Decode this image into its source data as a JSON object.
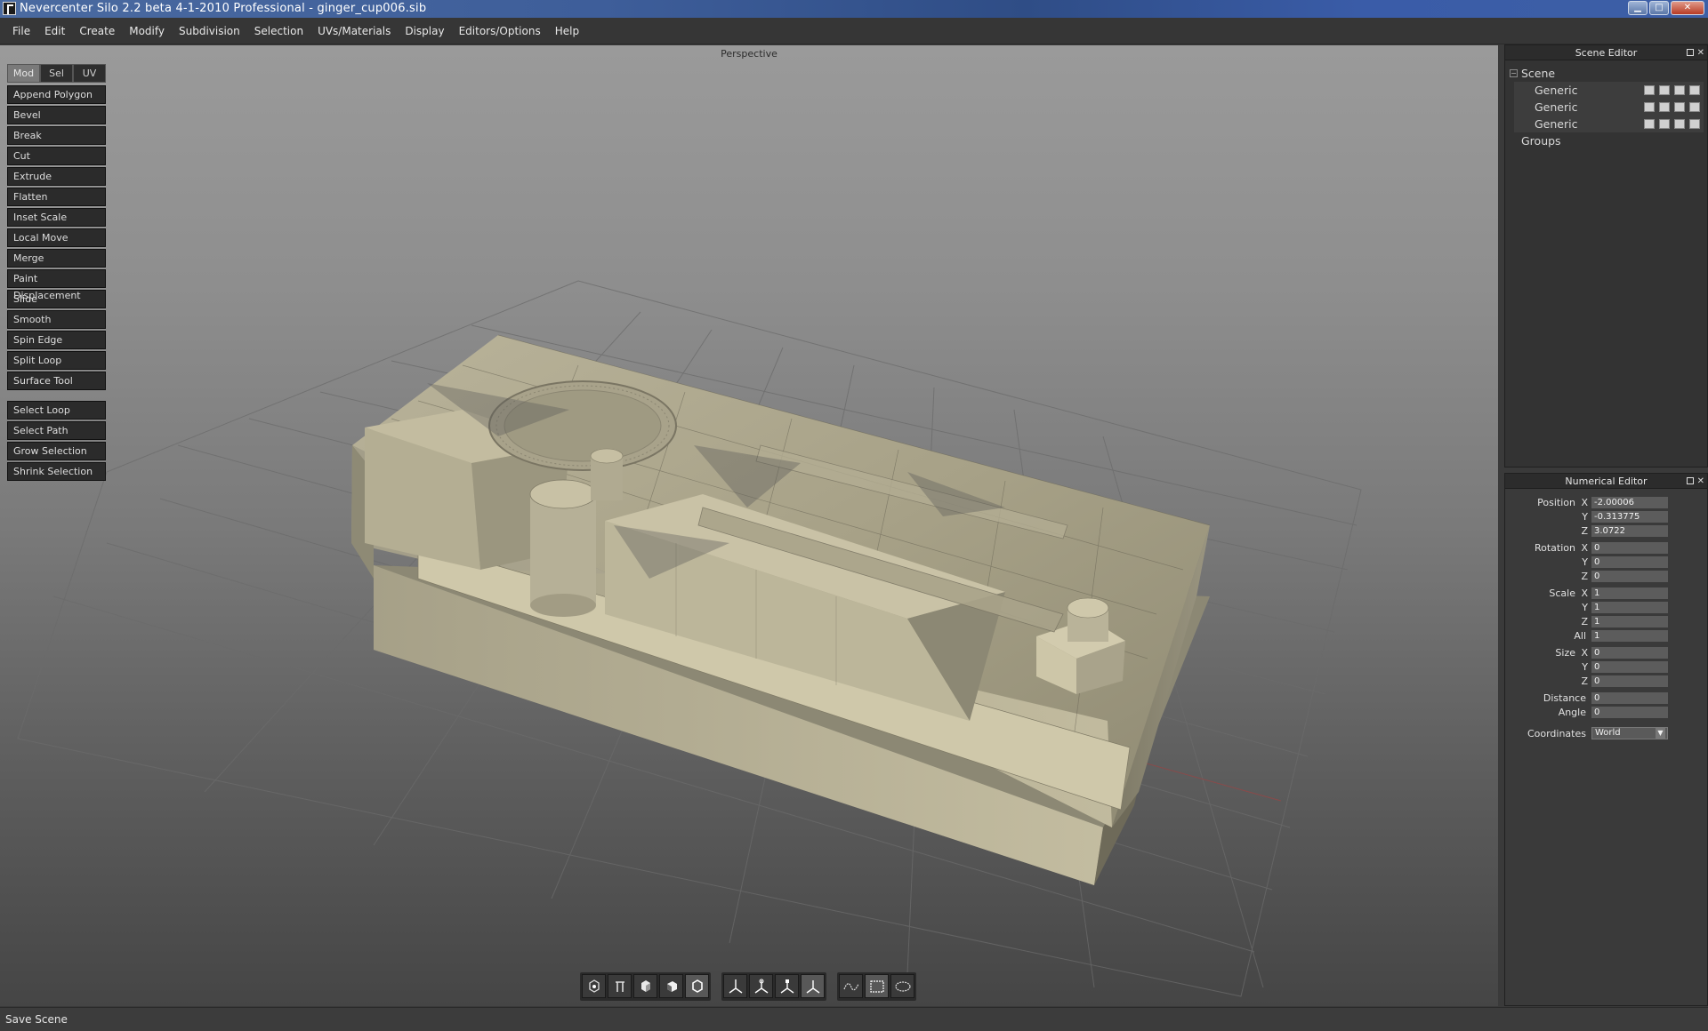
{
  "window": {
    "title": "Nevercenter Silo 2.2 beta 4-1-2010 Professional - ginger_cup006.sib"
  },
  "menu": [
    "File",
    "Edit",
    "Create",
    "Modify",
    "Subdivision",
    "Selection",
    "UVs/Materials",
    "Display",
    "Editors/Options",
    "Help"
  ],
  "viewport": {
    "label": "Perspective"
  },
  "toolpanel": {
    "tabs": [
      "Mod",
      "Sel",
      "UV"
    ],
    "active_tab": "Mod",
    "modeling_tools": [
      "Append Polygon",
      "Bevel",
      "Break",
      "Cut",
      "Extrude",
      "Flatten",
      "Inset Scale",
      "Local Move",
      "Merge",
      "Paint Displacement",
      "Slide",
      "Smooth",
      "Spin Edge",
      "Split Loop",
      "Surface Tool"
    ],
    "selection_tools": [
      "Select Loop",
      "Select Path",
      "Grow Selection",
      "Shrink Selection"
    ]
  },
  "scene_editor": {
    "title": "Scene Editor",
    "root": "Scene",
    "objects": [
      "Generic",
      "Generic",
      "Generic"
    ],
    "groups": "Groups"
  },
  "numerical_editor": {
    "title": "Numerical Editor",
    "position": {
      "label": "Position",
      "x": "-2.00006",
      "y": "-0.313775",
      "z": "3.0722"
    },
    "rotation": {
      "label": "Rotation",
      "x": "0",
      "y": "0",
      "z": "0"
    },
    "scale": {
      "label": "Scale",
      "x": "1",
      "y": "1",
      "z": "1",
      "all_label": "All",
      "all": "1"
    },
    "size": {
      "label": "Size",
      "x": "0",
      "y": "0",
      "z": "0"
    },
    "distance": {
      "label": "Distance",
      "value": "0"
    },
    "angle": {
      "label": "Angle",
      "value": "0"
    },
    "coordinates": {
      "label": "Coordinates",
      "value": "World"
    },
    "axes": {
      "x": "X",
      "y": "Y",
      "z": "Z"
    }
  },
  "bottom_toolbar": {
    "display_modes": [
      "vertex-mode-icon",
      "edge-mode-icon",
      "face-mode-icon",
      "object-mode-icon",
      "polygon-mode-icon"
    ],
    "manipulators": [
      "move-manipulator-icon",
      "rotate-manipulator-icon",
      "scale-manipulator-icon",
      "universal-manipulator-icon"
    ],
    "selection_modes": [
      "paint-select-icon",
      "box-select-icon",
      "lasso-select-icon"
    ]
  },
  "status": {
    "text": "Save Scene"
  }
}
